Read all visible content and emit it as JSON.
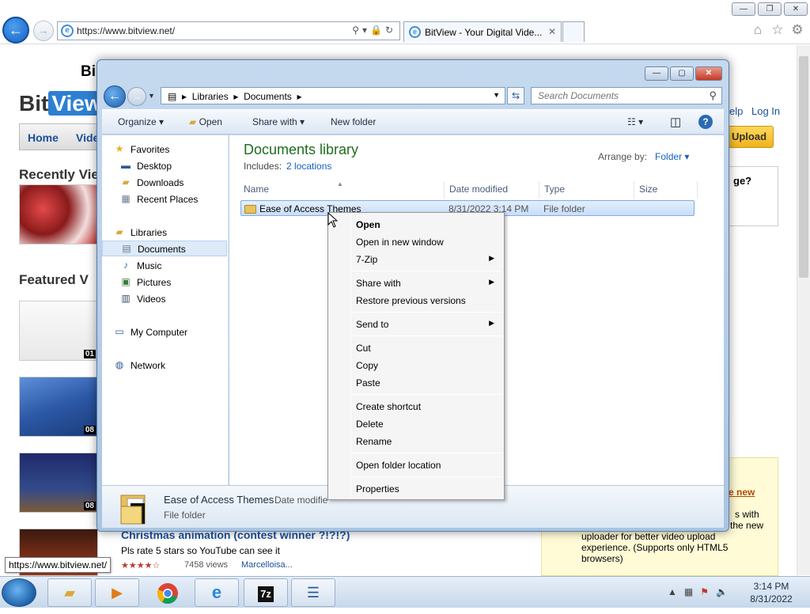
{
  "browser": {
    "address_url": "https://www.bitview.net/",
    "tab_title": "BitView - Your Digital Vide...",
    "tooltip_url": "https://www.bitview.net/"
  },
  "page": {
    "logo_bit": "Bit",
    "logo_view": "View",
    "header_partial": "Bi",
    "nav_home": "Home",
    "nav_videos_partial": "Vide",
    "help_partial": "elp",
    "login": "Log In",
    "upload": "Upload",
    "recently_viewed_partial": "Recently Vie",
    "featured_partial": "Featured V",
    "sidebox_partial": "ge?",
    "featured_durations": [
      "01",
      "08",
      "08"
    ],
    "video_title_partial": "Christmas animation (contest winner ?!?!?)",
    "video_desc": "Pls rate 5 stars so YouTube can see it",
    "video_views": "7458 views",
    "video_user": "Marcelloisa...",
    "stars": "★★★★☆",
    "promo_link_partial": "e new",
    "promo_text_lines": [
      "s with",
      "the new",
      "uploader for better video upload",
      "experience. (Supports only HTML5",
      "browsers)"
    ]
  },
  "explorer": {
    "breadcrumb": [
      "Libraries",
      "Documents"
    ],
    "search_placeholder": "Search Documents",
    "toolbar": {
      "organize": "Organize",
      "open": "Open",
      "share_with": "Share with",
      "new_folder": "New folder"
    },
    "nav": {
      "favorites": "Favorites",
      "desktop": "Desktop",
      "downloads": "Downloads",
      "recent_places": "Recent Places",
      "libraries": "Libraries",
      "documents": "Documents",
      "music": "Music",
      "pictures": "Pictures",
      "videos": "Videos",
      "my_computer": "My Computer",
      "network": "Network"
    },
    "library_title": "Documents library",
    "includes_label": "Includes:",
    "locations_link": "2 locations",
    "arrange_label": "Arrange by:",
    "arrange_value": "Folder",
    "columns": [
      "Name",
      "Date modified",
      "Type",
      "Size"
    ],
    "files": [
      {
        "name": "Ease of Access Themes",
        "date": "8/31/2022 3:14 PM",
        "type": "File folder"
      }
    ],
    "details": {
      "name": "Ease of Access Themes",
      "date_label": "Date modifie",
      "type": "File folder"
    }
  },
  "context_menu": {
    "items": [
      {
        "label": "Open",
        "bold": true
      },
      {
        "label": "Open in new window"
      },
      {
        "label": "7-Zip",
        "submenu": true
      },
      {
        "label": "Share with",
        "submenu": true
      },
      {
        "label": "Restore previous versions"
      },
      {
        "label": "Send to",
        "submenu": true
      },
      {
        "label": "Cut"
      },
      {
        "label": "Copy"
      },
      {
        "label": "Paste"
      },
      {
        "label": "Create shortcut"
      },
      {
        "label": "Delete"
      },
      {
        "label": "Rename"
      },
      {
        "label": "Open folder location"
      },
      {
        "label": "Properties"
      }
    ]
  },
  "taskbar": {
    "time": "3:14 PM",
    "date": "8/31/2022",
    "apps": [
      "file-explorer-icon",
      "media-player-icon",
      "chrome-icon",
      "internet-explorer-icon",
      "7zip-icon",
      "notepad-icon"
    ]
  },
  "colors": {
    "accent": "#1560c0",
    "library_title": "#1e6d1e",
    "selection": "#c9defa"
  }
}
